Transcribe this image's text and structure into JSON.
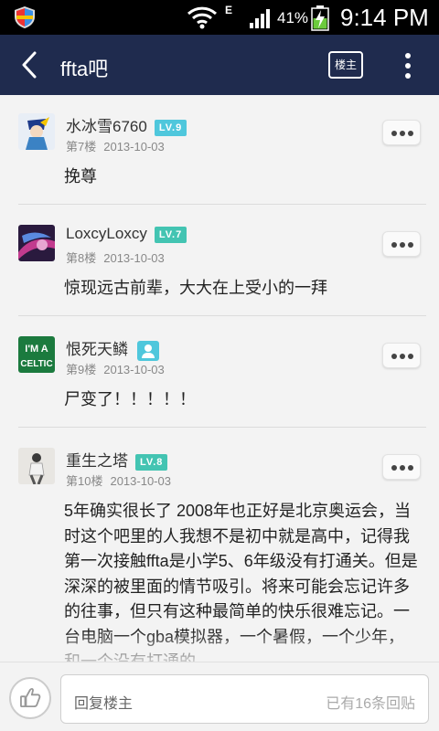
{
  "status_bar": {
    "network": "E",
    "battery": "41%",
    "time": "9:14 PM"
  },
  "header": {
    "title": "ffta吧",
    "owner_button": "楼主"
  },
  "posts": [
    {
      "author": "水冰雪6760",
      "level": "LV.9",
      "floor": "第7楼",
      "date": "2013-10-03",
      "content": "挽尊"
    },
    {
      "author": "LoxcyLoxcy",
      "level": "LV.7",
      "floor": "第8楼",
      "date": "2013-10-03",
      "content": "惊现远古前辈，大大在上受小的一拜"
    },
    {
      "author": "恨死天鳞",
      "floor": "第9楼",
      "date": "2013-10-03",
      "content": "尸变了！！！！！"
    },
    {
      "author": "重生之塔",
      "level": "LV.8",
      "floor": "第10楼",
      "date": "2013-10-03",
      "content": "5年确实很长了 2008年也正好是北京奥运会，当时这个吧里的人我想不是初中就是高中，记得我第一次接触ffta是小学5、6年级没有打通关。但是深深的被里面的情节吸引。将来可能会忘记许多的往事，但只有这种最简单的快乐很难忘记。一台电脑一个gba模拟器，一个暑假，一个少年，和一个没有打通的"
    }
  ],
  "avatar3_text": {
    "line1": "I'M A",
    "line2": "CELTIC"
  },
  "reply_bar": {
    "placeholder": "回复楼主",
    "reply_count": "已有16条回贴"
  },
  "colors": {
    "app_bar": "#1f2b4e",
    "level_badge": "#4fc7dc",
    "background": "#f3f3f3"
  },
  "icons": {
    "back": "chevron-left-icon",
    "more": "overflow-menu-icon",
    "post_menu": "ellipsis-icon",
    "like": "thumbs-up-icon"
  }
}
